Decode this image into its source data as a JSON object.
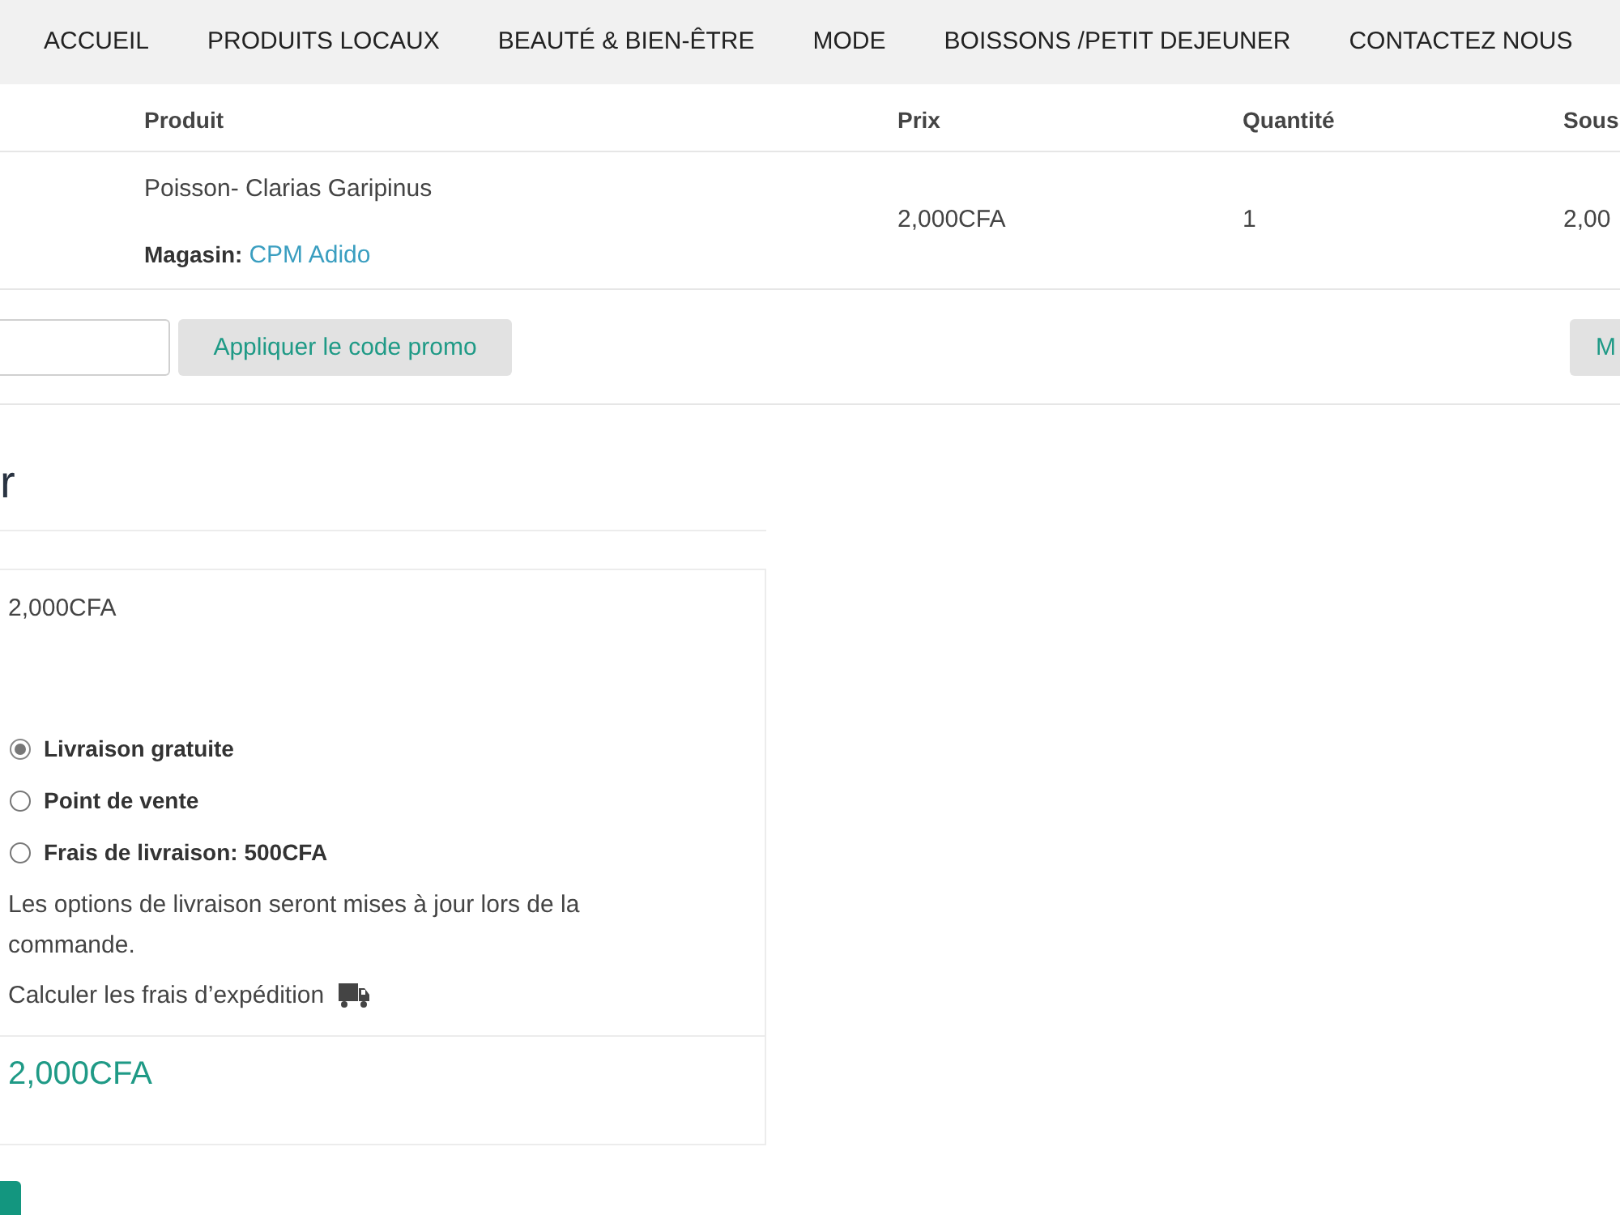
{
  "nav": {
    "items": [
      {
        "label": "ACCUEIL"
      },
      {
        "label": "PRODUITS LOCAUX"
      },
      {
        "label": "BEAUTÉ & BIEN-ÊTRE"
      },
      {
        "label": "MODE"
      },
      {
        "label": "BOISSONS /PETIT DEJEUNER"
      },
      {
        "label": "CONTACTEZ NOUS"
      }
    ]
  },
  "cart_table": {
    "columns": [
      "Produit",
      "Prix",
      "Quantité",
      "Sous"
    ],
    "rows": [
      {
        "product": "Poisson- Clarias Garipinus",
        "store_label": "Magasin:",
        "store": "CPM Adido",
        "price": "2,000CFA",
        "quantity": "1",
        "column_4": "2,00"
      }
    ]
  },
  "coupon": {
    "button": "Appliquer le code promo"
  },
  "update_button": "M",
  "totals": {
    "heading": "r",
    "subtotal": "2,000CFA",
    "shipping_options": [
      {
        "label": "Livraison gratuite",
        "selected": true
      },
      {
        "label": "Point de vente",
        "selected": false
      },
      {
        "label": "Frais de livraison: 500CFA",
        "selected": false
      }
    ],
    "shipping_note": "Les options de livraison seront mises à jour lors de la commande.",
    "calculate_link": "Calculer les frais d’expédition",
    "total": "2,000CFA"
  }
}
